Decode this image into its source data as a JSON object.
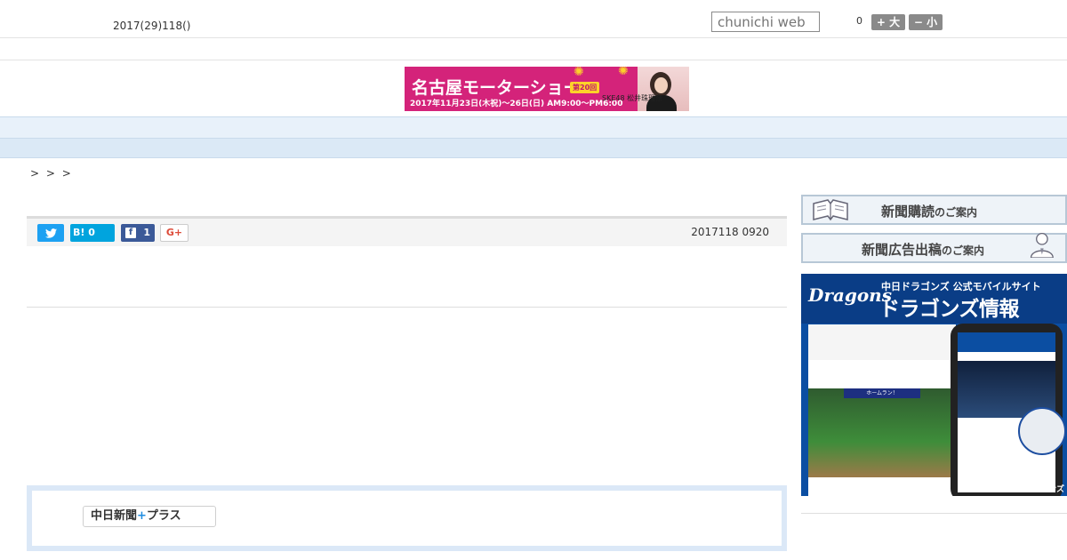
{
  "header": {
    "date": "2017(29)118()",
    "search_placeholder": "chunichi web",
    "font_size_label": "0",
    "font_bigger_label": "+ 大",
    "font_smaller_label": "− 小"
  },
  "banner": {
    "title": "名古屋モーターショー",
    "badge": "第20回",
    "dates": "2017年11月23日(木祝)〜26日(日) AM9:00〜PM6:00",
    "sponsor": "SKE48 松井珠理奈"
  },
  "nav": {
    "items": [
      "  ",
      "  ",
      "  ",
      "  ",
      "  ",
      "  ",
      "  ",
      "  ",
      "  "
    ]
  },
  "breadcrumb": "> > >",
  "share": {
    "hatena_label": "B!",
    "hatena_count": "0",
    "facebook_count": "1",
    "gplus_label": "G+",
    "timestamp": "2017118 0920"
  },
  "plus": {
    "logo_text_a": "中日新聞",
    "logo_plus": "+",
    "logo_text_b": "プラス"
  },
  "sidebar": {
    "subscribe_main": "新聞購読",
    "subscribe_suffix": "のご案内",
    "ad_main": "新聞広告出稿",
    "ad_suffix": "のご案内",
    "dragons_logo": "Dragons",
    "dragons_sub": "中日ドラゴンズ 公式モバイルサイト",
    "dragons_title": "ドラゴンズ情報",
    "dragons_homerun": "ホームラン！",
    "dragons_copyright": "© 中日ドラゴンズ"
  },
  "colors": {
    "nav_bg": "#e8f1fa",
    "banner_bg": "#d4237a",
    "dragons_blue": "#0b4ea2",
    "twitter": "#1da1f2",
    "hatena": "#00a4de",
    "facebook": "#3b5998"
  }
}
